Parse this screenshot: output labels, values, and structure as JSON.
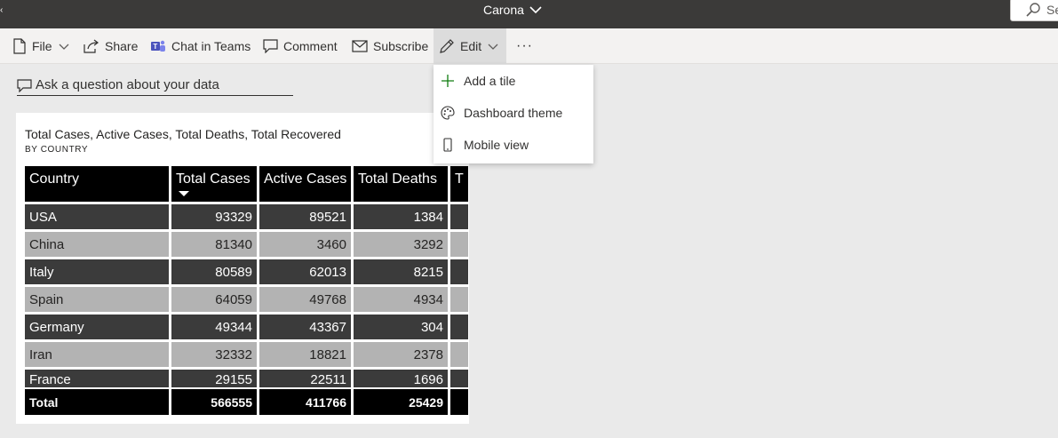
{
  "titlebar": {
    "title": "Carona",
    "search_placeholder": "Se"
  },
  "commandbar": {
    "file": "File",
    "share": "Share",
    "chat_in_teams": "Chat in Teams",
    "comment": "Comment",
    "subscribe": "Subscribe",
    "edit": "Edit",
    "more": "···"
  },
  "qa": {
    "placeholder": "Ask a question about your data"
  },
  "edit_menu": {
    "items": [
      {
        "label": "Add a tile",
        "icon": "plus-icon"
      },
      {
        "label": "Dashboard theme",
        "icon": "palette-icon"
      },
      {
        "label": "Mobile view",
        "icon": "phone-icon"
      }
    ]
  },
  "tile": {
    "title": "Total Cases, Active Cases, Total Deaths, Total Recovered",
    "subtitle": "BY COUNTRY",
    "table": {
      "headers": [
        "Country",
        "Total Cases",
        "Active Cases",
        "Total Deaths",
        "T"
      ],
      "rows": [
        [
          "USA",
          "93329",
          "89521",
          "1384"
        ],
        [
          "China",
          "81340",
          "3460",
          "3292"
        ],
        [
          "Italy",
          "80589",
          "62013",
          "8215"
        ],
        [
          "Spain",
          "64059",
          "49768",
          "4934"
        ],
        [
          "Germany",
          "49344",
          "43367",
          "304"
        ],
        [
          "Iran",
          "32332",
          "18821",
          "2378"
        ],
        [
          "France",
          "29155",
          "22511",
          "1696"
        ]
      ],
      "total": [
        "Total",
        "566555",
        "411766",
        "25429"
      ]
    }
  },
  "colors": {
    "titlebar": "#3b3a39",
    "row_dark": "#3b3b3b",
    "row_light": "#b3b3b3",
    "header": "#000000",
    "accent_green": "#107c10"
  }
}
